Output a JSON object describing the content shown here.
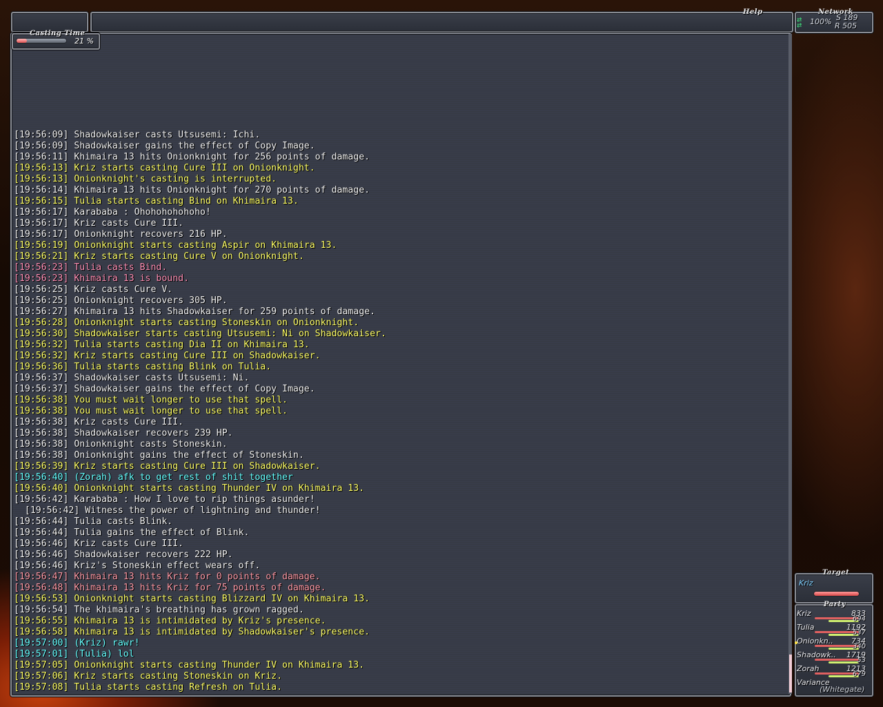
{
  "header": {
    "help_label": "Help"
  },
  "network": {
    "label": "Network",
    "percent": "100%",
    "send": "S 189",
    "recv": "R 505"
  },
  "casting": {
    "label": "Casting Time",
    "percent_text": "21 %",
    "progress": 0.21
  },
  "chat": {
    "lines": [
      {
        "text": "[19:56:09] Shadowkaiser casts Utsusemi: Ichi.",
        "color": "white"
      },
      {
        "text": "[19:56:09] Shadowkaiser gains the effect of Copy Image.",
        "color": "white"
      },
      {
        "text": "[19:56:11] Khimaira 13 hits Onionknight for 256 points of damage.",
        "color": "white"
      },
      {
        "text": "[19:56:13] Kriz starts casting Cure III on Onionknight.",
        "color": "yellow"
      },
      {
        "text": "[19:56:13] Onionknight's casting is interrupted.",
        "color": "yellow"
      },
      {
        "text": "[19:56:14] Khimaira 13 hits Onionknight for 270 points of damage.",
        "color": "white"
      },
      {
        "text": "[19:56:15] Tulia starts casting Bind on Khimaira 13.",
        "color": "yellow"
      },
      {
        "text": "[19:56:17] Karababa : Ohohohohohoho!",
        "color": "white"
      },
      {
        "text": "[19:56:17] Kriz casts Cure III.",
        "color": "white"
      },
      {
        "text": "[19:56:17] Onionknight recovers 216 HP.",
        "color": "white"
      },
      {
        "text": "[19:56:19] Onionknight starts casting Aspir on Khimaira 13.",
        "color": "yellow"
      },
      {
        "text": "[19:56:21] Kriz starts casting Cure V on Onionknight.",
        "color": "yellow"
      },
      {
        "text": "[19:56:23] Tulia casts Bind.",
        "color": "pink"
      },
      {
        "text": "[19:56:23] Khimaira 13 is bound.",
        "color": "pink"
      },
      {
        "text": "[19:56:25] Kriz casts Cure V.",
        "color": "white"
      },
      {
        "text": "[19:56:25] Onionknight recovers 305 HP.",
        "color": "white"
      },
      {
        "text": "[19:56:27] Khimaira 13 hits Shadowkaiser for 259 points of damage.",
        "color": "white"
      },
      {
        "text": "[19:56:28] Onionknight starts casting Stoneskin on Onionknight.",
        "color": "yellow"
      },
      {
        "text": "[19:56:30] Shadowkaiser starts casting Utsusemi: Ni on Shadowkaiser.",
        "color": "yellow"
      },
      {
        "text": "[19:56:32] Tulia starts casting Dia II on Khimaira 13.",
        "color": "yellow"
      },
      {
        "text": "[19:56:32] Kriz starts casting Cure III on Shadowkaiser.",
        "color": "yellow"
      },
      {
        "text": "[19:56:36] Tulia starts casting Blink on Tulia.",
        "color": "yellow"
      },
      {
        "text": "[19:56:37] Shadowkaiser casts Utsusemi: Ni.",
        "color": "white"
      },
      {
        "text": "[19:56:37] Shadowkaiser gains the effect of Copy Image.",
        "color": "white"
      },
      {
        "text": "[19:56:38] You must wait longer to use that spell.",
        "color": "yellow"
      },
      {
        "text": "[19:56:38] You must wait longer to use that spell.",
        "color": "yellow"
      },
      {
        "text": "[19:56:38] Kriz casts Cure III.",
        "color": "white"
      },
      {
        "text": "[19:56:38] Shadowkaiser recovers 239 HP.",
        "color": "white"
      },
      {
        "text": "[19:56:38] Onionknight casts Stoneskin.",
        "color": "white"
      },
      {
        "text": "[19:56:38] Onionknight gains the effect of Stoneskin.",
        "color": "white"
      },
      {
        "text": "[19:56:39] Kriz starts casting Cure III on Shadowkaiser.",
        "color": "yellow"
      },
      {
        "text": "[19:56:40] (Zorah) afk to get rest of shit together",
        "color": "cyan"
      },
      {
        "text": "[19:56:40] Onionknight starts casting Thunder IV on Khimaira 13.",
        "color": "yellow"
      },
      {
        "text": "[19:56:42] Karababa : How I love to rip things asunder!",
        "color": "white"
      },
      {
        "text": "  [19:56:42] Witness the power of lightning and thunder!",
        "color": "white"
      },
      {
        "text": "[19:56:44] Tulia casts Blink.",
        "color": "white"
      },
      {
        "text": "[19:56:44] Tulia gains the effect of Blink.",
        "color": "white"
      },
      {
        "text": "[19:56:46] Kriz casts Cure III.",
        "color": "white"
      },
      {
        "text": "[19:56:46] Shadowkaiser recovers 222 HP.",
        "color": "white"
      },
      {
        "text": "[19:56:46] Kriz's Stoneskin effect wears off.",
        "color": "white"
      },
      {
        "text": "[19:56:47] Khimaira 13 hits Kriz for 0 points of damage.",
        "color": "salmon"
      },
      {
        "text": "[19:56:48] Khimaira 13 hits Kriz for 75 points of damage.",
        "color": "salmon"
      },
      {
        "text": "[19:56:53] Onionknight starts casting Blizzard IV on Khimaira 13.",
        "color": "yellow"
      },
      {
        "text": "[19:56:54] The khimaira's breathing has grown ragged.",
        "color": "white"
      },
      {
        "text": "[19:56:55] Khimaira 13 is intimidated by Kriz's presence.",
        "color": "yellow"
      },
      {
        "text": "[19:56:58] Khimaira 13 is intimidated by Shadowkaiser's presence.",
        "color": "yellow"
      },
      {
        "text": "[19:57:00] (Kriz) rawr!",
        "color": "cyan"
      },
      {
        "text": "[19:57:01] (Tulia) lol",
        "color": "cyan"
      },
      {
        "text": "[19:57:05] Onionknight starts casting Thunder IV on Khimaira 13.",
        "color": "yellow"
      },
      {
        "text": "[19:57:06] Kriz starts casting Stoneskin on Kriz.",
        "color": "yellow"
      },
      {
        "text": "[19:57:08] Tulia starts casting Refresh on Tulia.",
        "color": "yellow"
      }
    ]
  },
  "target": {
    "label": "Target",
    "name": "Kriz",
    "hp_fraction": 0.96
  },
  "party": {
    "label": "Party",
    "members": [
      {
        "name": "Kriz",
        "hp": "833",
        "mp": "694"
      },
      {
        "name": "Tulia",
        "hp": "1192",
        "mp": "537"
      },
      {
        "name": "Onionkn..",
        "hp": "734",
        "mp": "340"
      },
      {
        "name": "Shadowk..",
        "hp": "1719",
        "mp": "53"
      },
      {
        "name": "Zorah",
        "hp": "1213",
        "mp": "679"
      },
      {
        "name": "Variance",
        "hp": "",
        "mp": ""
      }
    ],
    "footer": "(Whitegate)"
  }
}
